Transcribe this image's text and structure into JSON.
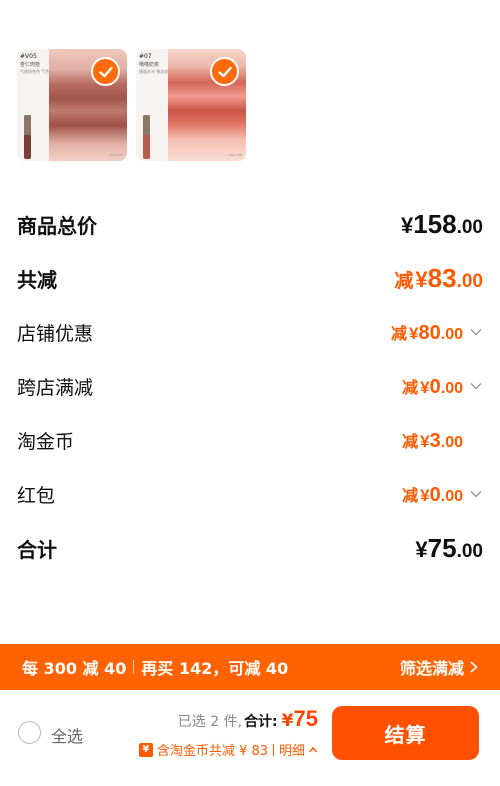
{
  "products": [
    {
      "code": "#V05",
      "name": "杏仁肉桂",
      "desc": "气质奶茶色 气色显白",
      "brand": "JOOCYEE"
    },
    {
      "code": "#07",
      "name": "噜噜奶茶",
      "desc": "镜面水光 果冻质感",
      "brand": "JOOCYEE"
    }
  ],
  "rows": {
    "total_price": {
      "label": "商品总价",
      "currency": "¥",
      "int": "158",
      "dec": ".00"
    },
    "total_discount": {
      "label": "共减",
      "prefix": "减",
      "currency": "¥",
      "int": "83",
      "dec": ".00"
    },
    "shop_discount": {
      "label": "店铺优惠",
      "prefix": "减",
      "currency": "¥",
      "int": "80",
      "dec": ".00"
    },
    "cross_shop": {
      "label": "跨店满减",
      "prefix": "减",
      "currency": "¥",
      "int": "0",
      "dec": ".00"
    },
    "taojinbi": {
      "label": "淘金币",
      "prefix": "减",
      "currency": "¥",
      "int": "3",
      "dec": ".00"
    },
    "hongbao": {
      "label": "红包",
      "prefix": "减",
      "currency": "¥",
      "int": "0",
      "dec": ".00"
    },
    "subtotal": {
      "label": "合计",
      "currency": "¥",
      "int": "75",
      "dec": ".00"
    }
  },
  "promo": {
    "rule": "每 300 减 40",
    "hint": "再买 142，可减 40",
    "filter": "筛选满减"
  },
  "bottom": {
    "select_all": "全选",
    "selected_count": "已选 2 件",
    "total_label": "合计:",
    "currency": "¥",
    "total_value": "75",
    "coin_icon": "¥",
    "coin_text": "含淘金币共减 ¥ 83",
    "detail": "明细",
    "checkout": "结算"
  },
  "colors": {
    "accent": "#ff5a00",
    "promo_bg": "#ff6200",
    "checkout_bg": "#ff5000"
  },
  "icons": {
    "check": "checkmark-icon",
    "chevron": "chevron-down-icon",
    "arrow": "chevron-right-icon",
    "coin": "coin-icon",
    "up": "chevron-up-icon"
  }
}
